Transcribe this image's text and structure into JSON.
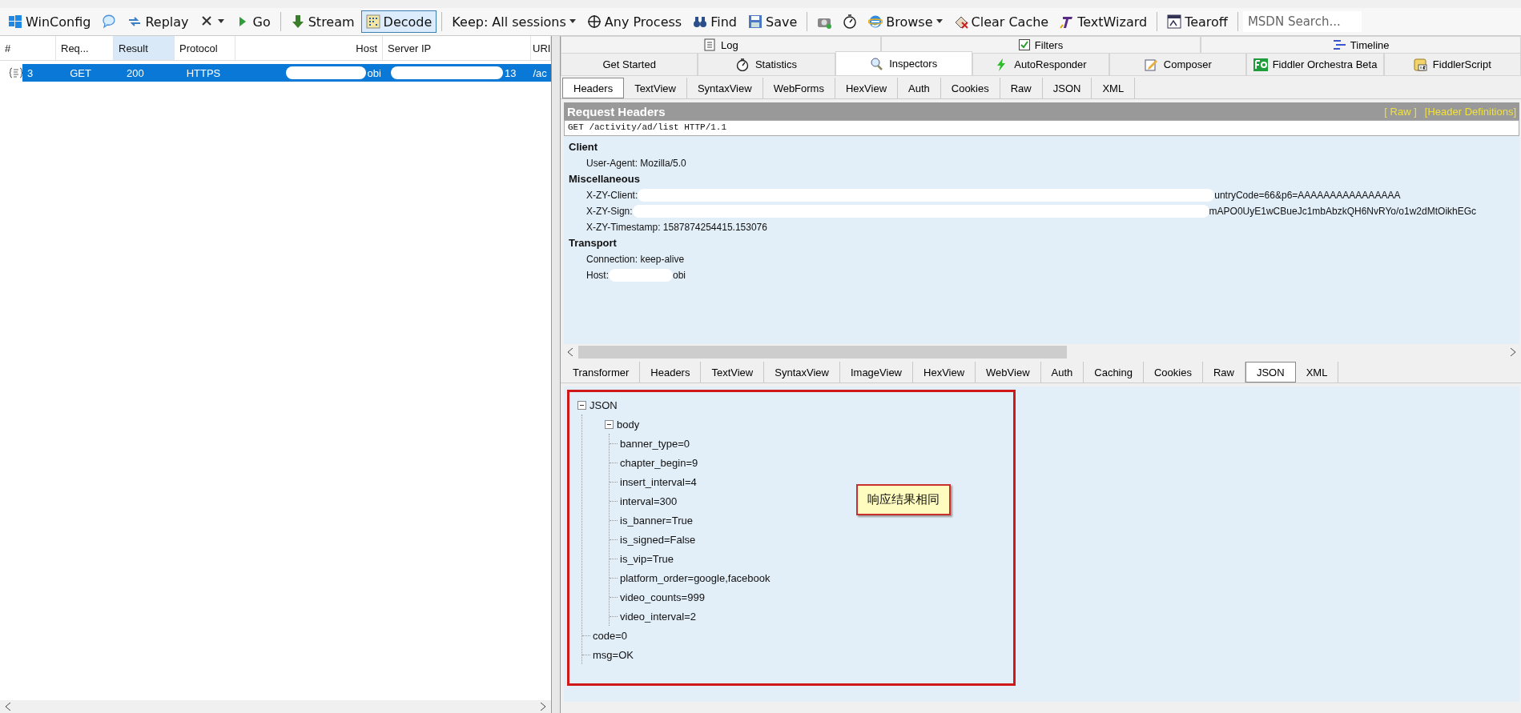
{
  "toolbar": [
    {
      "kind": "button",
      "label": "WinConfig"
    },
    {
      "kind": "button"
    },
    {
      "kind": "button",
      "label": "Replay"
    },
    {
      "kind": "button",
      "menu": true
    },
    {
      "kind": "button",
      "label": "Go"
    },
    {
      "kind": "separator"
    },
    {
      "kind": "button",
      "label": "Stream"
    },
    {
      "kind": "button",
      "label": "Decode",
      "pressed": true
    },
    {
      "kind": "separator"
    },
    {
      "kind": "button",
      "label": "Keep: All sessions",
      "menu": true
    },
    {
      "kind": "button",
      "label": "Any Process"
    },
    {
      "kind": "button",
      "label": "Find"
    },
    {
      "kind": "button",
      "label": "Save"
    },
    {
      "kind": "separator"
    },
    {
      "kind": "button"
    },
    {
      "kind": "button"
    },
    {
      "kind": "button",
      "label": "Browse",
      "menu": true
    },
    {
      "kind": "button",
      "label": "Clear Cache"
    },
    {
      "kind": "button",
      "label": "TextWizard"
    },
    {
      "kind": "separator"
    },
    {
      "kind": "button",
      "label": "Tearoff"
    },
    {
      "kind": "separator"
    },
    {
      "kind": "search",
      "placeholder": "MSDN Search..."
    }
  ],
  "sessions": {
    "columns": [
      "#",
      "Req...",
      "Result",
      "Protocol",
      "Host",
      "Server IP",
      "URI"
    ],
    "rows": [
      {
        "selected": true,
        "cells": [
          "3",
          "GET",
          "200",
          "HTTPS",
          "obi",
          "13",
          "/ac"
        ]
      }
    ]
  },
  "tabs_top": [
    {
      "label": "Log",
      "selected": false
    },
    {
      "label": "Filters",
      "selected": false,
      "checked": true
    },
    {
      "label": "Timeline",
      "selected": false
    }
  ],
  "tabs": [
    {
      "label": "Get Started",
      "selected": false
    },
    {
      "label": "Statistics",
      "selected": false
    },
    {
      "label": "Inspectors",
      "selected": true
    },
    {
      "label": "AutoResponder",
      "selected": false
    },
    {
      "label": "Composer",
      "selected": false
    },
    {
      "label": "Fiddler Orchestra Beta",
      "selected": false
    },
    {
      "label": "FiddlerScript",
      "selected": false
    }
  ],
  "request": {
    "tabs": [
      {
        "label": "Headers",
        "selected": true
      },
      {
        "label": "TextView",
        "selected": false
      },
      {
        "label": "SyntaxView",
        "selected": false
      },
      {
        "label": "WebForms",
        "selected": false
      },
      {
        "label": "HexView",
        "selected": false
      },
      {
        "label": "Auth",
        "selected": false
      },
      {
        "label": "Cookies",
        "selected": false
      },
      {
        "label": "Raw",
        "selected": false
      },
      {
        "label": "JSON",
        "selected": false
      },
      {
        "label": "XML",
        "selected": false
      }
    ],
    "title": "Request Headers",
    "links": [
      "[ Raw ]",
      "[Header Definitions]"
    ],
    "request_line": "GET /activity/ad/list HTTP/1.1",
    "groups": [
      {
        "name": "Client",
        "headers": [
          {
            "text": "User-Agent: Mozilla/5.0"
          }
        ]
      },
      {
        "name": "Miscellaneous",
        "headers": [
          {
            "text": "X-ZY-Client:",
            "redacted": true,
            "value": "untryCode=66&p6=AAAAAAAAAAAAAAAA"
          },
          {
            "text": "X-ZY-Sign:",
            "redacted": true,
            "value": "mAPO0UyE1wCBueJc1mbAbzkQH6NvRYo/o1w2dMtOikhEGc"
          },
          {
            "text": "X-ZY-Timestamp: 1587874254415.153076"
          }
        ]
      },
      {
        "name": "Transport",
        "headers": [
          {
            "text": "Connection: keep-alive"
          },
          {
            "text": "Host:",
            "redacted": true,
            "value": "obi"
          }
        ]
      }
    ]
  },
  "response": {
    "tabs": [
      {
        "label": "Transformer",
        "selected": false
      },
      {
        "label": "Headers",
        "selected": false
      },
      {
        "label": "TextView",
        "selected": false
      },
      {
        "label": "SyntaxView",
        "selected": false
      },
      {
        "label": "ImageView",
        "selected": false
      },
      {
        "label": "HexView",
        "selected": false
      },
      {
        "label": "WebView",
        "selected": false
      },
      {
        "label": "Auth",
        "selected": false
      },
      {
        "label": "Caching",
        "selected": false
      },
      {
        "label": "Cookies",
        "selected": false
      },
      {
        "label": "Raw",
        "selected": false
      },
      {
        "label": "JSON",
        "selected": true
      },
      {
        "label": "XML",
        "selected": false
      }
    ],
    "tree": [
      {
        "label": "JSON",
        "expanded": true,
        "children": [
          {
            "label": "body",
            "expanded": true,
            "children": [
              {
                "label": "banner_type=0"
              },
              {
                "label": "chapter_begin=9"
              },
              {
                "label": "insert_interval=4"
              },
              {
                "label": "interval=300"
              },
              {
                "label": "is_banner=True"
              },
              {
                "label": "is_signed=False"
              },
              {
                "label": "is_vip=True"
              },
              {
                "label": "platform_order=google,facebook"
              },
              {
                "label": "video_counts=999"
              },
              {
                "label": "video_interval=2"
              }
            ]
          },
          {
            "label": "code=0"
          },
          {
            "label": "msg=OK"
          }
        ]
      }
    ],
    "callout": "响应结果相同"
  }
}
